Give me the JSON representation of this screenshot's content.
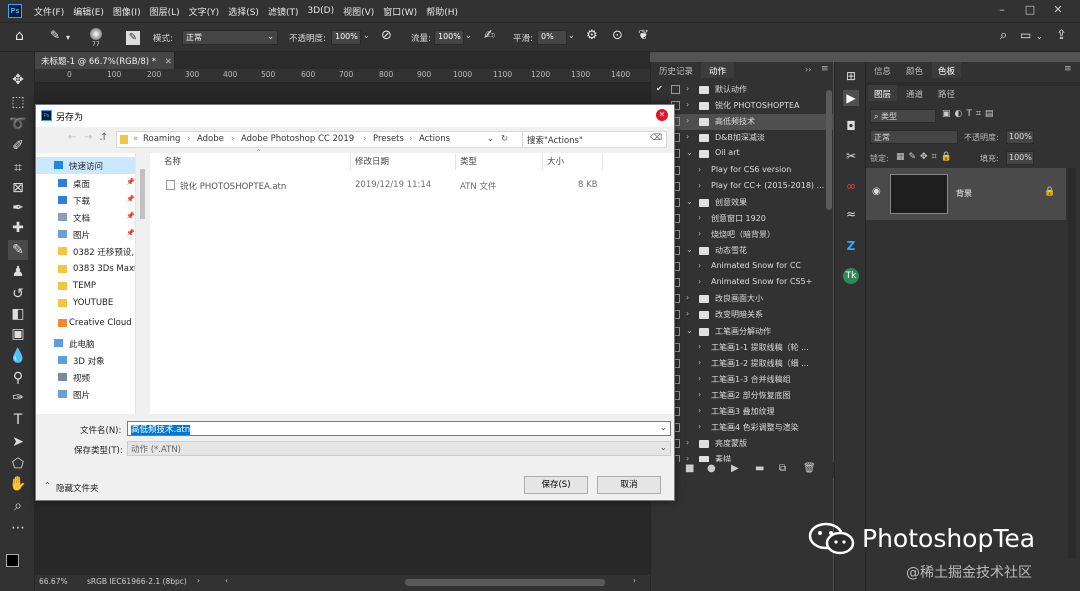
{
  "menubar": {
    "logo": "Ps",
    "items": [
      "文件(F)",
      "编辑(E)",
      "图像(I)",
      "图层(L)",
      "文字(Y)",
      "选择(S)",
      "滤镜(T)",
      "3D(D)",
      "视图(V)",
      "窗口(W)",
      "帮助(H)"
    ]
  },
  "options": {
    "brush_size": "77",
    "mode_label": "模式:",
    "mode_value": "正常",
    "opacity_label": "不透明度:",
    "opacity_value": "100%",
    "flow_label": "流量:",
    "flow_value": "100%",
    "smoothing_label": "平滑:",
    "smoothing_value": "0%"
  },
  "document": {
    "tab_title": "未标题-1 @ 66.7%(RGB/8) *",
    "ruler_ticks": [
      "0",
      "100",
      "200",
      "300",
      "400",
      "500",
      "600",
      "700",
      "800",
      "900",
      "1000",
      "1100",
      "1200",
      "1300",
      "1400"
    ],
    "zoom": "66.67%",
    "profile": "sRGB IEC61966-2.1 (8bpc)"
  },
  "actions_panel": {
    "tabs": [
      "历史记录",
      "动作"
    ],
    "rows": [
      {
        "label": "默认动作",
        "kind": "set",
        "checked": true
      },
      {
        "label": "锐化 PHOTOSHOPTEA",
        "kind": "set",
        "checked": false
      },
      {
        "label": "高低频技术",
        "kind": "set",
        "checked": false
      },
      {
        "label": "D&B加深减淡",
        "kind": "set",
        "checked": false
      },
      {
        "label": "Oil art",
        "kind": "open",
        "checked": false
      },
      {
        "label": "Play for CS6 version",
        "kind": "action",
        "checked": false
      },
      {
        "label": "Play for CC+ (2015-2018) ...",
        "kind": "action",
        "checked": false
      },
      {
        "label": "创意效果",
        "kind": "open",
        "checked": false
      },
      {
        "label": "创意窗口 1920",
        "kind": "action",
        "checked": false
      },
      {
        "label": "烧烧吧（暗背景）",
        "kind": "action",
        "checked": false
      },
      {
        "label": "动态雪花",
        "kind": "open",
        "checked": false
      },
      {
        "label": "Animated Snow for CC",
        "kind": "action",
        "checked": false
      },
      {
        "label": "Animated Snow for CS5+",
        "kind": "action",
        "checked": false
      },
      {
        "label": "改良画面大小",
        "kind": "set",
        "checked": false
      },
      {
        "label": "改变明暗关系",
        "kind": "set",
        "checked": false
      },
      {
        "label": "工笔画分解动作",
        "kind": "open",
        "checked": false
      },
      {
        "label": "工笔画1-1 提取线稿（轮 ...",
        "kind": "action",
        "checked": false
      },
      {
        "label": "工笔画1-2 提取线稿（细 ...",
        "kind": "action",
        "checked": false
      },
      {
        "label": "工笔画1-3 合并线稿组",
        "kind": "action",
        "checked": false
      },
      {
        "label": "工笔画2 部分恢复底图",
        "kind": "action",
        "checked": false
      },
      {
        "label": "工笔画3 叠加纹理",
        "kind": "action",
        "checked": false
      },
      {
        "label": "工笔画4 色彩调整与渲染",
        "kind": "action",
        "checked": false
      },
      {
        "label": "亮度蒙版",
        "kind": "set",
        "checked": false
      },
      {
        "label": "素描",
        "kind": "set",
        "checked": false
      }
    ]
  },
  "right_panel": {
    "top_tabs": [
      "信息",
      "颜色",
      "色板"
    ],
    "layer_tabs": [
      "图层",
      "通道",
      "路径"
    ],
    "filter_label": "类型",
    "blend_mode": "正常",
    "opacity_label": "不透明度:",
    "opacity_value": "100%",
    "lock_label": "锁定:",
    "fill_label": "填充:",
    "fill_value": "100%",
    "layer_name": "背景"
  },
  "dialog": {
    "title": "另存为",
    "path": [
      "Roaming",
      "Adobe",
      "Adobe Photoshop CC 2019",
      "Presets",
      "Actions"
    ],
    "path_prefix": "«",
    "search_placeholder": "搜索\"Actions\"",
    "nav": [
      {
        "label": "快速访问",
        "kind": "star",
        "selected": true
      },
      {
        "label": "桌面",
        "kind": "desktop",
        "selected": false
      },
      {
        "label": "下载",
        "kind": "download",
        "selected": false
      },
      {
        "label": "文档",
        "kind": "doc",
        "selected": false
      },
      {
        "label": "图片",
        "kind": "pic",
        "selected": false
      },
      {
        "label": "0382 迁移预设,",
        "kind": "folder",
        "selected": false
      },
      {
        "label": "0383 3Ds Maxt",
        "kind": "folder",
        "selected": false
      },
      {
        "label": "TEMP",
        "kind": "folder",
        "selected": false
      },
      {
        "label": "YOUTUBE",
        "kind": "folder",
        "selected": false
      },
      {
        "label": "Creative Cloud F",
        "kind": "cc",
        "selected": false
      },
      {
        "label": "此电脑",
        "kind": "pc",
        "selected": false
      },
      {
        "label": "3D 对象",
        "kind": "3d",
        "selected": false
      },
      {
        "label": "视频",
        "kind": "video",
        "selected": false
      },
      {
        "label": "图片",
        "kind": "pic",
        "selected": false
      }
    ],
    "columns": [
      "名称",
      "修改日期",
      "类型",
      "大小"
    ],
    "files": [
      {
        "name": "锐化 PHOTOSHOPTEA.atn",
        "date": "2019/12/19 11:14",
        "type": "ATN 文件",
        "size": "8 KB"
      }
    ],
    "filename_label": "文件名(N):",
    "filename_value": "高低频技术.atn",
    "filetype_label": "保存类型(T):",
    "filetype_value": "动作 (*.ATN)",
    "hide_folders": "隐藏文件夹",
    "save_label": "保存(S)",
    "cancel_label": "取消"
  },
  "watermark": {
    "brand": "PhotoshopTea",
    "community": "@稀土掘金技术社区"
  },
  "colors": {
    "ps_blue": "#31a8ff",
    "selection_blue": "#cce8ff",
    "close_red": "#e81123"
  }
}
